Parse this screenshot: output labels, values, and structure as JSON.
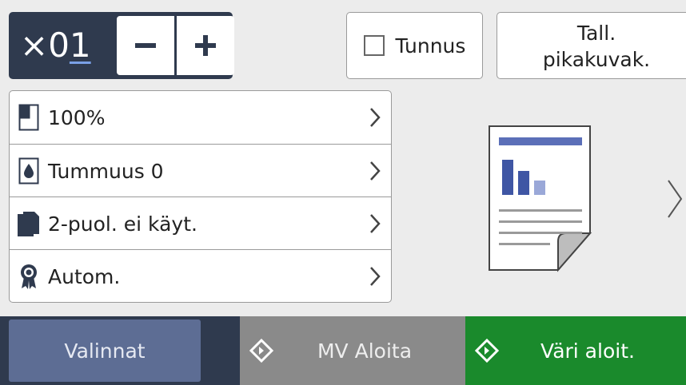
{
  "copies": {
    "prefix": "×0",
    "digit": "1",
    "minus_label": "−",
    "plus_label": "+"
  },
  "top_buttons": {
    "id_copy_label": "Tunnus",
    "shortcut_line1": "Tall.",
    "shortcut_line2": "pikakuvak."
  },
  "settings": [
    {
      "label": "100%",
      "icon": "page-size-icon"
    },
    {
      "label": "Tummuus 0",
      "icon": "density-drop-icon"
    },
    {
      "label": "2-puol. ei käyt.",
      "icon": "duplex-icon"
    },
    {
      "label": "Autom.",
      "icon": "quality-ribbon-icon"
    }
  ],
  "bottom": {
    "options_label": "Valinnat",
    "mono_start_label": "MV Aloita",
    "color_start_label": "Väri aloit."
  },
  "colors": {
    "header_dark": "#2f3a4e",
    "options_button": "#5d6d94",
    "mono_button": "#8a8a8a",
    "color_button": "#1a8a2c",
    "accent_blue": "#5b6fb8"
  }
}
